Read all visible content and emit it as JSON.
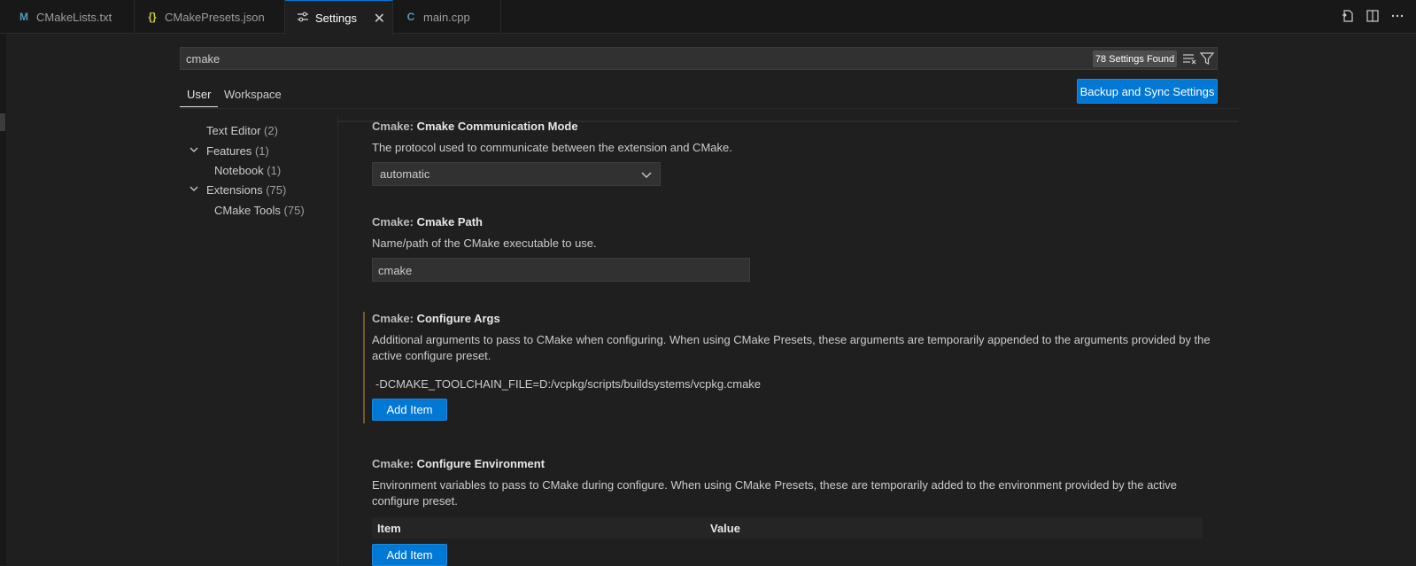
{
  "tabs": [
    {
      "label": "CMakeLists.txt",
      "icon": "M",
      "icon_color": "#519aba"
    },
    {
      "label": "CMakePresets.json",
      "icon": "{}",
      "icon_color": "#cbcb41"
    },
    {
      "label": "Settings",
      "icon": "settings-sliders-icon"
    },
    {
      "label": "main.cpp",
      "icon": "C",
      "icon_color": "#519aba"
    }
  ],
  "tab_close": "✕",
  "search": {
    "value": "cmake",
    "found": "78 Settings Found"
  },
  "scope": {
    "user": "User",
    "workspace": "Workspace",
    "sync_button": "Backup and Sync Settings"
  },
  "toc": {
    "items": [
      {
        "label": "Text Editor",
        "count": "(2)"
      },
      {
        "label": "Features",
        "count": "(1)"
      },
      {
        "label": "Notebook",
        "count": "(1)"
      },
      {
        "label": "Extensions",
        "count": "(75)"
      },
      {
        "label": "CMake Tools",
        "count": "(75)"
      }
    ]
  },
  "settings": {
    "comm": {
      "category": "Cmake: ",
      "name": "Cmake Communication Mode",
      "desc": "The protocol used to communicate between the extension and CMake.",
      "value": "automatic"
    },
    "path": {
      "category": "Cmake: ",
      "name": "Cmake Path",
      "desc": "Name/path of the CMake executable to use.",
      "value": "cmake"
    },
    "args": {
      "category": "Cmake: ",
      "name": "Configure Args",
      "desc": "Additional arguments to pass to CMake when configuring. When using CMake Presets, these arguments are temporarily appended to the arguments provided by the active configure preset.",
      "item": "-DCMAKE_TOOLCHAIN_FILE=D:/vcpkg/scripts/buildsystems/vcpkg.cmake",
      "add_label": "Add Item"
    },
    "env": {
      "category": "Cmake: ",
      "name": "Configure Environment",
      "desc": "Environment variables to pass to CMake during configure. When using CMake Presets, these are temporarily added to the environment provided by the active configure preset.",
      "col_item": "Item",
      "col_value": "Value",
      "add_label": "Add Item"
    }
  }
}
